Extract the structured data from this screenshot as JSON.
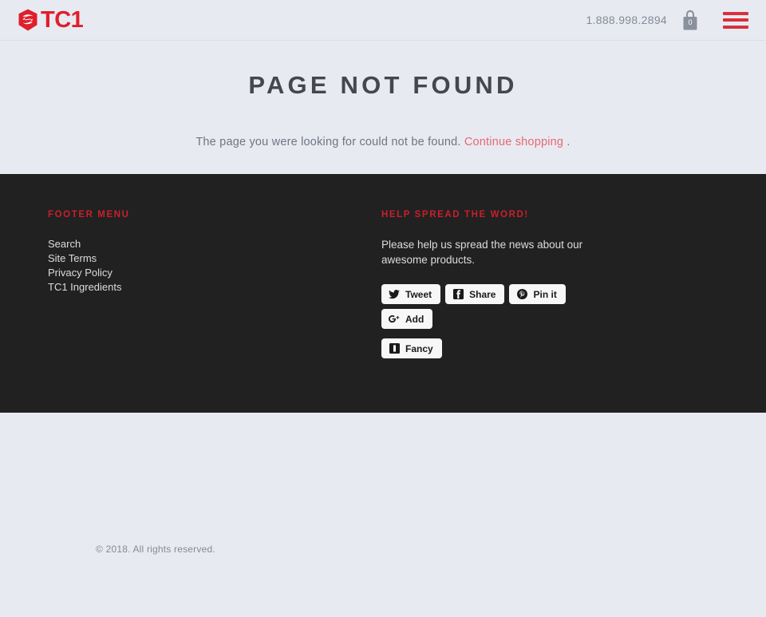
{
  "header": {
    "logo_text": "TC1",
    "logo_icon": "tc1-shield-logo",
    "phone": "1.888.998.2894",
    "cart_icon": "shopping-bag-icon",
    "cart_count": "0",
    "menu_icon": "hamburger-menu-icon",
    "accent_color": "#e01f2b",
    "menu_color": "#d8303c"
  },
  "main": {
    "title": "PAGE NOT FOUND",
    "message_before": "The page you were looking for could not be found.",
    "link_label": "Continue shopping",
    "message_after": ".",
    "link_color": "#e8686f",
    "title_color": "#44474d",
    "background_color": "#e8eaf2"
  },
  "footer": {
    "background_color": "#212121",
    "heading_color": "#c8202c",
    "menu": {
      "heading": "FOOTER MENU",
      "items": [
        {
          "label": "Search"
        },
        {
          "label": "Site Terms"
        },
        {
          "label": "Privacy Policy"
        },
        {
          "label": "TC1 Ingredients"
        }
      ]
    },
    "share": {
      "heading": "HELP SPREAD THE WORD!",
      "description": "Please help us spread the news about our awesome products.",
      "buttons": [
        {
          "label": "Tweet",
          "icon": "twitter-bird-icon"
        },
        {
          "label": "Share",
          "icon": "facebook-icon"
        },
        {
          "label": "Pin it",
          "icon": "pinterest-icon"
        },
        {
          "label": "Add",
          "icon": "google-plus-icon"
        },
        {
          "label": "Fancy",
          "icon": "fancy-icon"
        }
      ]
    },
    "copyright": "© 2018. All rights reserved."
  }
}
